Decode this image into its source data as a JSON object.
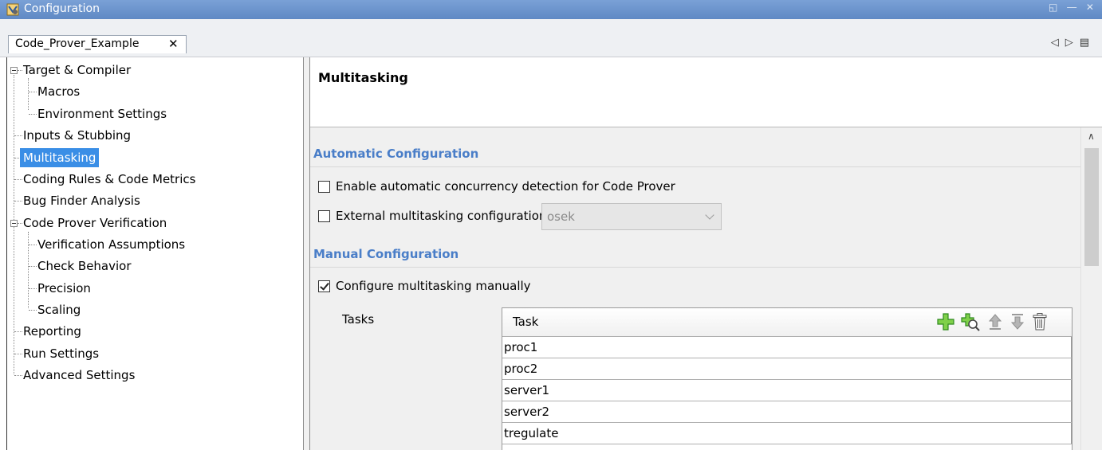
{
  "window": {
    "title": "Configuration",
    "controls": "◱ ― ✕"
  },
  "tabs": [
    {
      "label": "Code_Prover_Example",
      "close": "✕"
    }
  ],
  "tab_nav": {
    "back": "◁",
    "forward": "▷",
    "menu": "▤"
  },
  "tree": {
    "items": [
      {
        "label": "Target & Compiler",
        "level": 0,
        "expanded": true
      },
      {
        "label": "Macros",
        "level": 1
      },
      {
        "label": "Environment Settings",
        "level": 1
      },
      {
        "label": "Inputs & Stubbing",
        "level": 0
      },
      {
        "label": "Multitasking",
        "level": 0,
        "selected": true
      },
      {
        "label": "Coding Rules & Code Metrics",
        "level": 0
      },
      {
        "label": "Bug Finder Analysis",
        "level": 0
      },
      {
        "label": "Code Prover Verification",
        "level": 0,
        "expanded": true
      },
      {
        "label": "Verification Assumptions",
        "level": 1
      },
      {
        "label": "Check Behavior",
        "level": 1
      },
      {
        "label": "Precision",
        "level": 1
      },
      {
        "label": "Scaling",
        "level": 1
      },
      {
        "label": "Reporting",
        "level": 0
      },
      {
        "label": "Run Settings",
        "level": 0
      },
      {
        "label": "Advanced Settings",
        "level": 0
      }
    ]
  },
  "panel": {
    "title": "Multitasking",
    "automatic": {
      "heading": "Automatic Configuration",
      "auto_detect": {
        "label": "Enable automatic concurrency detection for Code Prover",
        "checked": false
      },
      "external": {
        "label": "External multitasking configuration",
        "checked": false,
        "select_value": "osek"
      }
    },
    "manual": {
      "heading": "Manual Configuration",
      "configure": {
        "label": "Configure multitasking manually",
        "checked": true
      },
      "tasks_label": "Tasks",
      "table": {
        "header": "Task",
        "toolbar": [
          "add-icon",
          "add-search-icon",
          "move-up-icon",
          "move-down-icon",
          "trash-icon"
        ],
        "rows": [
          "proc1",
          "proc2",
          "server1",
          "server2",
          "tregulate"
        ]
      }
    }
  },
  "colors": {
    "selection": "#3a8ee6",
    "section_heading": "#4a7ec8",
    "titlebar": "#6a93cc"
  }
}
